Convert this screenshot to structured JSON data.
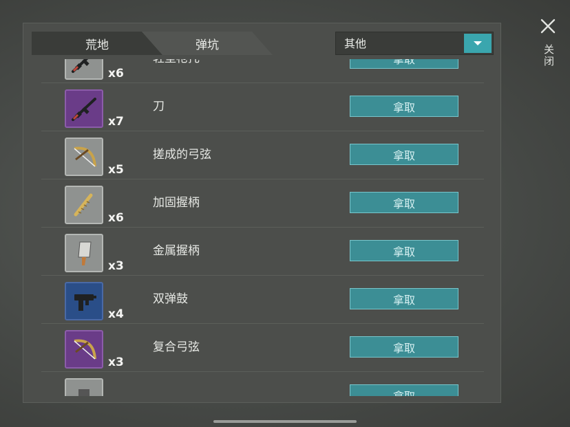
{
  "tabs": [
    {
      "label": "荒地"
    },
    {
      "label": "弹坑"
    }
  ],
  "dropdown": {
    "selected": "其他"
  },
  "close": {
    "label": "关闭"
  },
  "items": [
    {
      "name": "轻型枪托",
      "count": "x6",
      "rarity": "gray",
      "icon": "rifle-icon",
      "action": "拿取"
    },
    {
      "name": "刀",
      "count": "x7",
      "rarity": "purple",
      "icon": "rifle-icon",
      "action": "拿取"
    },
    {
      "name": "搓成的弓弦",
      "count": "x5",
      "rarity": "gray",
      "icon": "bow-icon",
      "action": "拿取"
    },
    {
      "name": "加固握柄",
      "count": "x6",
      "rarity": "gray",
      "icon": "grip-icon",
      "action": "拿取"
    },
    {
      "name": "金属握柄",
      "count": "x3",
      "rarity": "gray",
      "icon": "cleaver-icon",
      "action": "拿取"
    },
    {
      "name": "双弹鼓",
      "count": "x4",
      "rarity": "blue",
      "icon": "smg-icon",
      "action": "拿取"
    },
    {
      "name": "复合弓弦",
      "count": "x3",
      "rarity": "purple",
      "icon": "bow-icon",
      "action": "拿取"
    },
    {
      "name": "",
      "count": "",
      "rarity": "gray",
      "icon": "item-icon",
      "action": "拿取"
    }
  ]
}
